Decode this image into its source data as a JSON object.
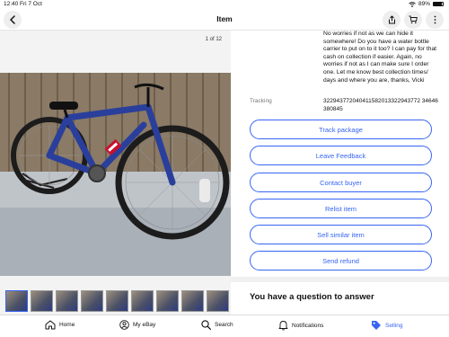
{
  "status_bar": {
    "time": "12:40",
    "date": "Fri 7 Oct",
    "wifi_icon": "wifi-icon",
    "battery_percent": "89%",
    "battery_level": 0.89
  },
  "header": {
    "title": "Item",
    "back_icon": "chevron-left-icon",
    "share_icon": "share-icon",
    "cart_icon": "cart-icon",
    "more_icon": "more-icon"
  },
  "gallery": {
    "counter": "1 of 12",
    "thumbnail_count": 9,
    "selected_thumbnail": 1
  },
  "detail": {
    "message": "No worries if not as we can hide it somewhere! Do you have a water bottle carrier to put on to it too? I can pay for that cash on collection if easier. Again, no worries if not as I can make sure I order one. Let me know best collection times/ days and where you are, thanks, Vicki",
    "tracking_label": "Tracking",
    "tracking_value": "322943772040411582013322943772 34646380845"
  },
  "actions": {
    "track_package": "Track package",
    "leave_feedback": "Leave Feedback",
    "contact_buyer": "Contact buyer",
    "relist_item": "Relist item",
    "sell_similar_item": "Sell similar item",
    "send_refund": "Send refund"
  },
  "section": {
    "question_heading": "You have a question to answer"
  },
  "tabs": {
    "home": "Home",
    "my_ebay": "My eBay",
    "search": "Search",
    "notifications": "Notifications",
    "selling": "Selling",
    "active": "selling"
  },
  "colors": {
    "accent": "#3665f3",
    "bike_frame": "#2a3f9c"
  }
}
